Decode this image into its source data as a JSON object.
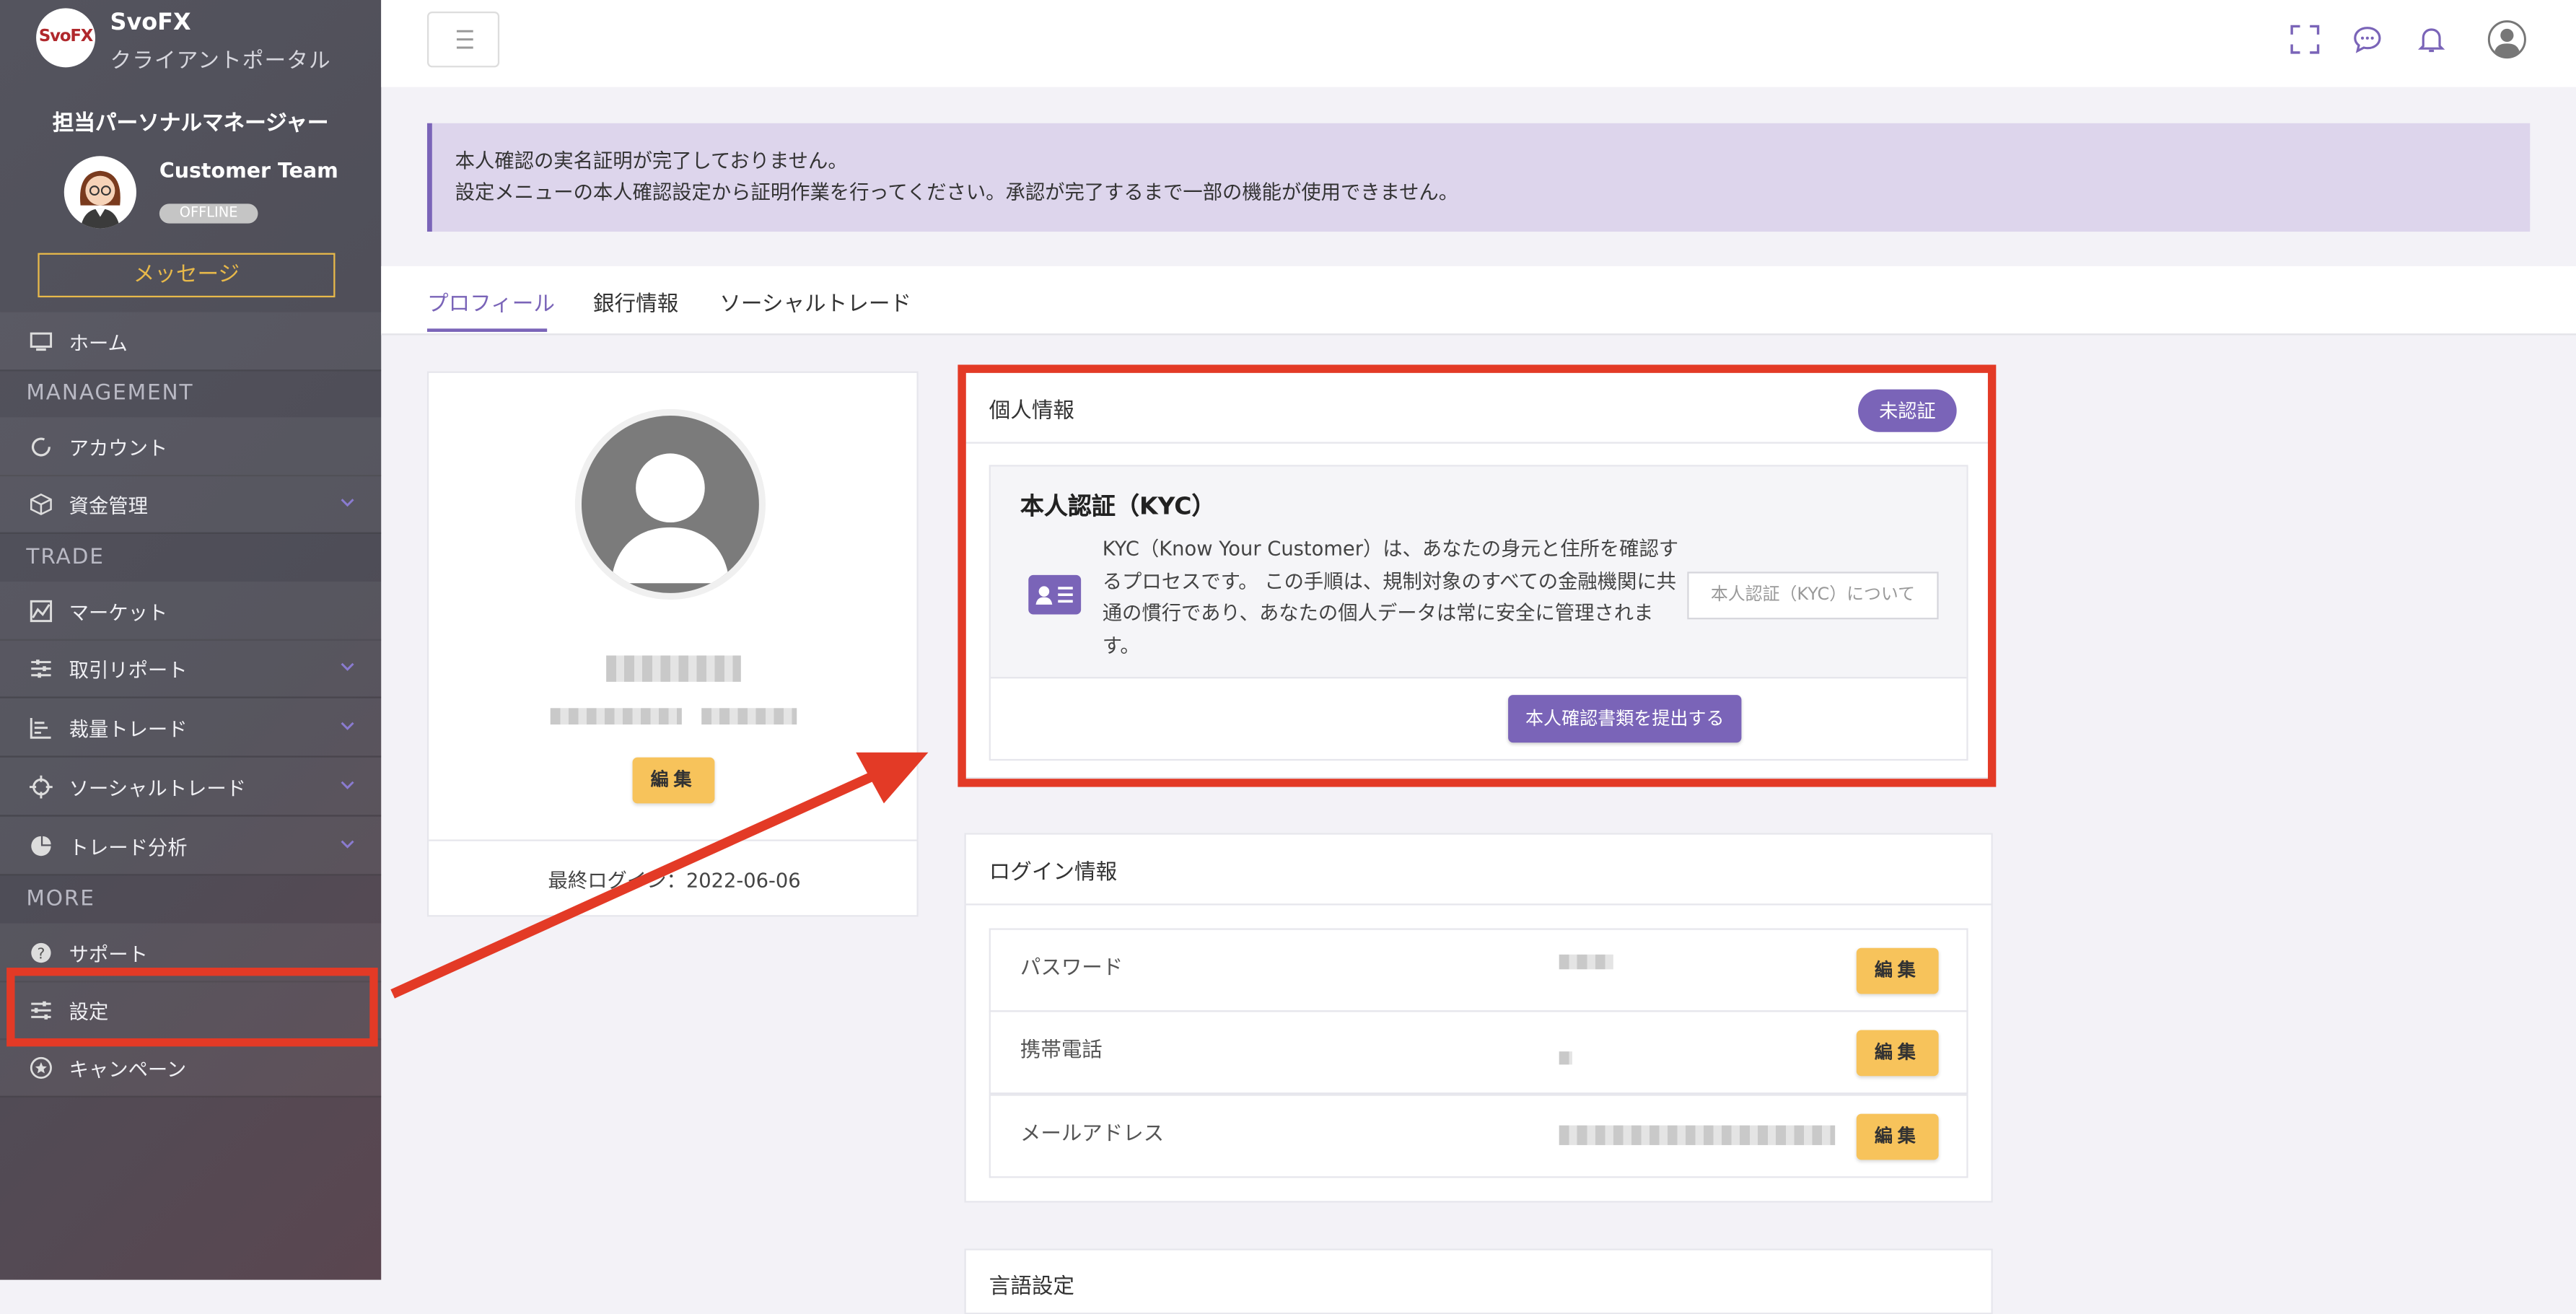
{
  "app": {
    "name": "SvoFX",
    "subtitle": "クライアントポータル",
    "logo_text": "SvoFX"
  },
  "manager": {
    "section_title": "担当パーソナルマネージャー",
    "name": "Customer Team",
    "status": "OFFLINE",
    "message_button": "メッセージ"
  },
  "sidebar": {
    "home": "ホーム",
    "sections": {
      "management": "MANAGEMENT",
      "trade": "TRADE",
      "more": "MORE"
    },
    "account": "アカウント",
    "funds": "資金管理",
    "market": "マーケット",
    "trade_report": "取引リポート",
    "discretionary_trade": "裁量トレード",
    "social_trade": "ソーシャルトレード",
    "trade_analysis": "トレード分析",
    "support": "サポート",
    "settings": "設定",
    "campaign": "キャンペーン"
  },
  "alert": {
    "line1": "本人確認の実名証明が完了しておりません。",
    "line2": "設定メニューの本人確認設定から証明作業を行ってください。承認が完了するまで一部の機能が使用できません。"
  },
  "tabs": {
    "profile": "プロフィール",
    "bank": "銀行情報",
    "social": "ソーシャルトレード"
  },
  "profile_card": {
    "edit_button": "編集",
    "last_login_label": "最終ログイン",
    "last_login_sep": "：",
    "last_login_value": "2022-06-06"
  },
  "personal_info": {
    "title": "個人情報",
    "badge": "未認証",
    "kyc_title": "本人認証（KYC）",
    "kyc_description": "KYC（Know Your Customer）は、あなたの身元と住所を確認するプロセスです。 この手順は、規制対象のすべての金融機関に共通の慣行であり、あなたの個人データは常に安全に管理されます。",
    "kyc_about_button": "本人認証（KYC）について",
    "submit_button": "本人確認書類を提出する"
  },
  "login_info": {
    "title": "ログイン情報",
    "rows": [
      {
        "label": "パスワード",
        "edit": "編集"
      },
      {
        "label": "携帯電話",
        "edit": "編集"
      },
      {
        "label": "メールアドレス",
        "edit": "編集"
      }
    ]
  },
  "next_card": {
    "title": "言語設定"
  },
  "colors": {
    "accent": "#7a64b8",
    "warning_button": "#f7c35b",
    "annotation": "#e33a26",
    "alert_bg": "#ddd5ec"
  },
  "icons": {
    "header": [
      "fullscreen-icon",
      "chat-icon",
      "bell-icon",
      "user-avatar-icon"
    ],
    "sidebar": [
      "monitor-icon",
      "circle-icon",
      "cube-icon",
      "chart-icon",
      "sliders-icon",
      "bars-icon",
      "crosshair-icon",
      "pie-icon",
      "question-icon",
      "settings-sliders-icon",
      "star-badge-icon"
    ]
  }
}
